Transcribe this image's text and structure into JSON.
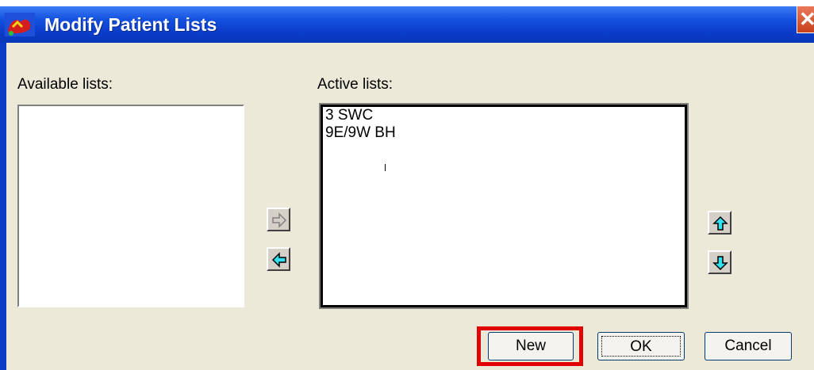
{
  "window": {
    "title": "Modify Patient Lists"
  },
  "labels": {
    "available": "Available lists:",
    "active": "Active lists:"
  },
  "available_lists": [],
  "active_lists": [
    {
      "label": "3 SWC"
    },
    {
      "label": "9E/9W BH"
    }
  ],
  "buttons": {
    "new": "New",
    "ok": "OK",
    "cancel": "Cancel"
  },
  "icons": {
    "add": "arrow-right-icon",
    "remove": "arrow-left-icon",
    "move_up": "arrow-up-icon",
    "move_down": "arrow-down-icon",
    "close": "close-icon"
  },
  "colors": {
    "titlebar": "#0a3dc9",
    "face": "#ece9d8",
    "arrow_active": "#33e0f0",
    "highlight": "#e00000"
  }
}
